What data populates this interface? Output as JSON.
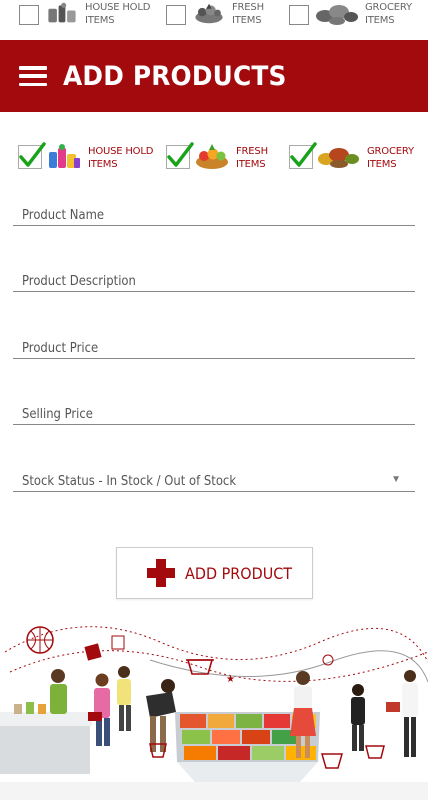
{
  "top_categories": [
    {
      "line1": "HOUSE HOLD",
      "line2": "ITEMS",
      "icon": "household-items-icon"
    },
    {
      "line1": "FRESH",
      "line2": "ITEMS",
      "icon": "fresh-items-icon"
    },
    {
      "line1": "GROCERY",
      "line2": "ITEMS",
      "icon": "grocery-items-icon"
    }
  ],
  "header": {
    "title": "ADD PRODUCTS",
    "menu_icon": "hamburger-menu-icon",
    "color": "#a30a0e"
  },
  "categories": [
    {
      "line1": "HOUSE HOLD",
      "line2": "ITEMS",
      "checked": true
    },
    {
      "line1": "FRESH",
      "line2": "ITEMS",
      "checked": true
    },
    {
      "line1": "GROCERY",
      "line2": "ITEMS",
      "checked": true
    }
  ],
  "form": {
    "product_name": {
      "value": "",
      "placeholder": "Product Name"
    },
    "product_description": {
      "value": "",
      "placeholder": "Product Description"
    },
    "product_price": {
      "value": "",
      "placeholder": "Product Price"
    },
    "selling_price": {
      "value": "",
      "placeholder": "Selling Price"
    },
    "stock_status": {
      "selected": "Stock Status - In Stock / Out of Stock"
    }
  },
  "add_button": {
    "label": "ADD PRODUCT",
    "icon": "red-cross-plus-icon"
  },
  "colors": {
    "accent": "#a30a0e",
    "check": "#1aa31a"
  }
}
